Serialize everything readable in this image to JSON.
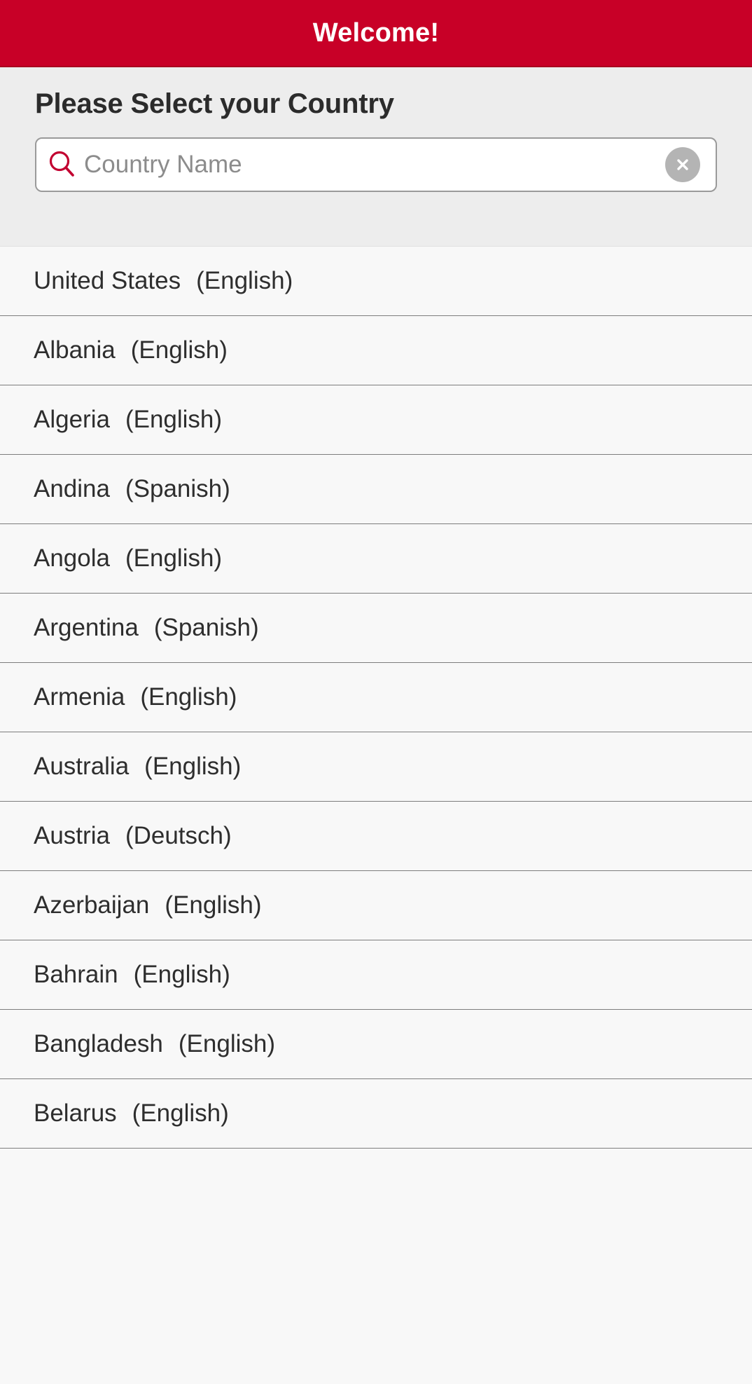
{
  "header": {
    "title": "Welcome!",
    "background_color": "#c80027",
    "text_color": "#ffffff"
  },
  "search_panel": {
    "prompt": "Please Select your Country",
    "search": {
      "value": "",
      "placeholder": "Country Name",
      "icon": "search-icon",
      "icon_color": "#c80027",
      "clear_icon": "close-circle-icon",
      "clear_color": "#b4b4b4"
    }
  },
  "country_list": {
    "items": [
      {
        "name": "United States",
        "language": "(English)"
      },
      {
        "name": "Albania",
        "language": "(English)"
      },
      {
        "name": "Algeria",
        "language": "(English)"
      },
      {
        "name": "Andina",
        "language": "(Spanish)"
      },
      {
        "name": "Angola",
        "language": "(English)"
      },
      {
        "name": "Argentina",
        "language": "(Spanish)"
      },
      {
        "name": "Armenia",
        "language": "(English)"
      },
      {
        "name": "Australia",
        "language": "(English)"
      },
      {
        "name": "Austria",
        "language": "(Deutsch)"
      },
      {
        "name": "Azerbaijan",
        "language": "(English)"
      },
      {
        "name": "Bahrain",
        "language": "(English)"
      },
      {
        "name": "Bangladesh",
        "language": "(English)"
      },
      {
        "name": "Belarus",
        "language": "(English)"
      }
    ]
  }
}
